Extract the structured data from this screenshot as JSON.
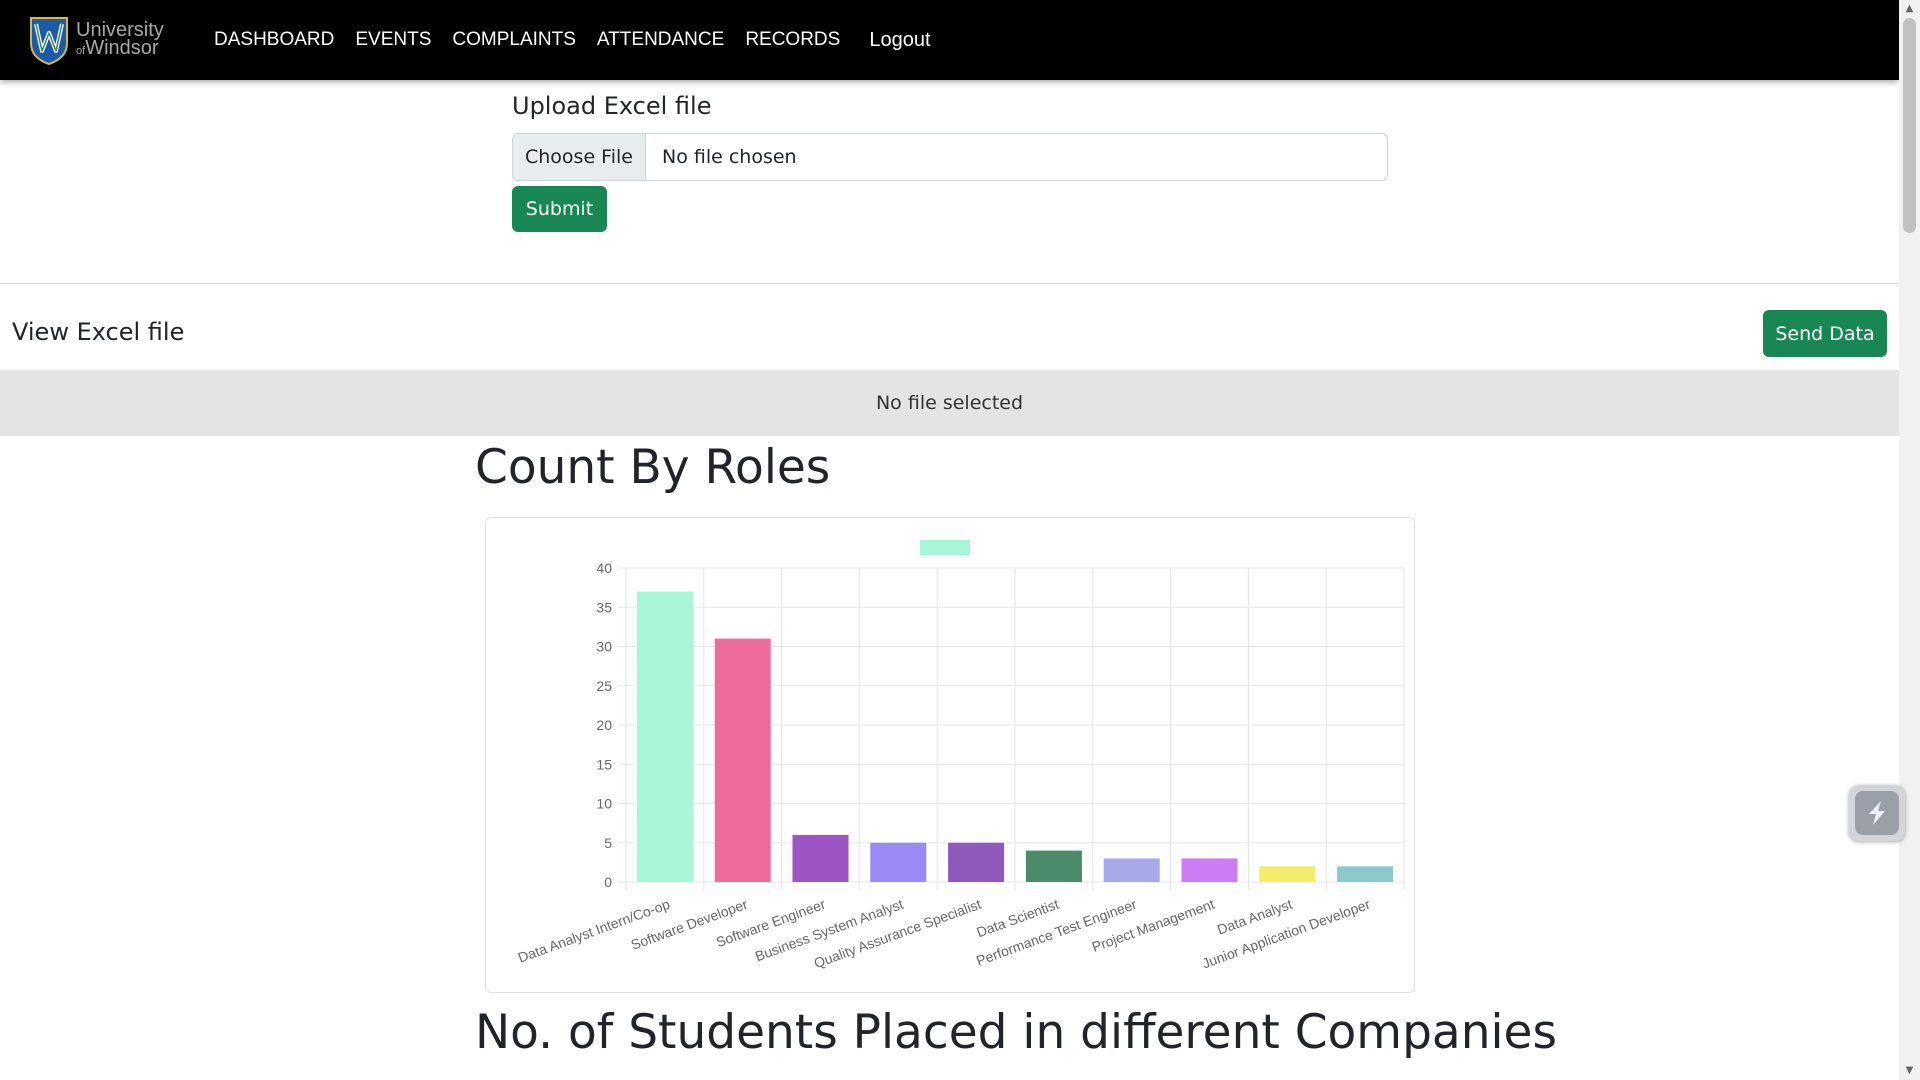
{
  "header": {
    "logo": {
      "line1": "University",
      "line2_small": "of",
      "line2": "Windsor"
    },
    "nav": [
      "DASHBOARD",
      "EVENTS",
      "COMPLAINTS",
      "ATTENDANCE",
      "RECORDS"
    ],
    "logout": "Logout"
  },
  "upload": {
    "title": "Upload Excel file",
    "choose_label": "Choose File",
    "file_status": "No file chosen",
    "submit_label": "Submit"
  },
  "view": {
    "title": "View Excel file",
    "send_label": "Send Data",
    "no_file_text": "No file selected"
  },
  "sections": {
    "count_by_roles": "Count By Roles",
    "students_placed": "No. of Students Placed in different Companies"
  },
  "colors": {
    "nav_bg": "#000000",
    "button_green": "#198754",
    "grid": "#e5e5e5"
  },
  "chart_data": {
    "type": "bar",
    "categories": [
      "Data Analyst Intern/Co-op",
      "Software Developer",
      "Software Engineer",
      "Business System Analyst",
      "Quality Assurance Specialist",
      "Data Scientist",
      "Performance Test Engineer",
      "Project Management",
      "Data Analyst",
      "Junior Application Developer"
    ],
    "values": [
      37,
      31,
      6,
      5,
      5,
      4,
      3,
      3,
      2,
      2
    ],
    "colors": [
      "#a8f5d8",
      "#ef6b9b",
      "#9d55c4",
      "#9a8af5",
      "#9058bd",
      "#4b8a6b",
      "#a7a8ea",
      "#cd7cf4",
      "#f2ee6c",
      "#8ec9c9"
    ],
    "legend_color": "#a8f5d8",
    "ylim": [
      0,
      40
    ],
    "yticks": [
      0,
      5,
      10,
      15,
      20,
      25,
      30,
      35,
      40
    ],
    "grid": true,
    "legend_position": "top-center"
  }
}
